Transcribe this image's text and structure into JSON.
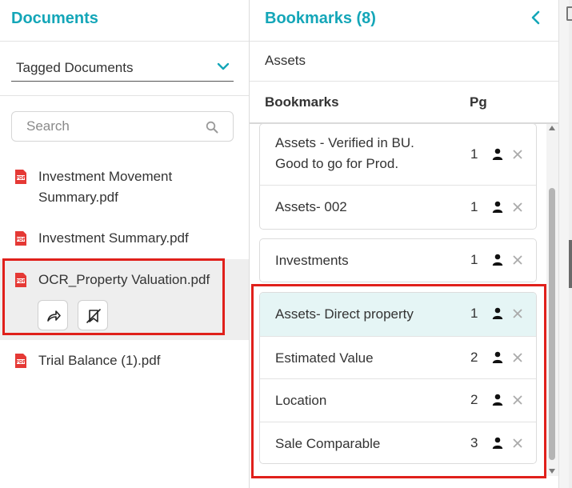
{
  "documents_panel": {
    "title": "Documents",
    "filter": {
      "selected": "Tagged Documents"
    },
    "search": {
      "placeholder": "Search",
      "value": ""
    },
    "items": [
      {
        "name_line1": "Investment Movement",
        "name_line2": "Summary.pdf"
      },
      {
        "name": "Investment Summary.pdf"
      },
      {
        "name": "OCR_Property Valuation.pdf",
        "selected": true
      },
      {
        "name": "Trial Balance (1).pdf"
      }
    ]
  },
  "bookmarks_panel": {
    "title": "Bookmarks (8)",
    "context": "Assets",
    "columns": {
      "bookmarks": "Bookmarks",
      "page": "Pg"
    },
    "groups": [
      {
        "rows": [
          {
            "label_line1": "Assets - Verified in BU.",
            "label_line2": "Good to go for Prod.",
            "page": "1"
          },
          {
            "label": "Assets- 002",
            "page": "1"
          }
        ]
      },
      {
        "rows": [
          {
            "label": "Investments",
            "page": "1"
          }
        ]
      },
      {
        "rows": [
          {
            "label": "Assets- Direct property",
            "page": "1",
            "active": true
          },
          {
            "label": "Estimated Value",
            "page": "2"
          },
          {
            "label": "Location",
            "page": "2"
          },
          {
            "label": "Sale Comparable",
            "page": "3"
          }
        ]
      }
    ]
  },
  "colors": {
    "accent": "#14a6b8",
    "highlight_border": "#e0201b",
    "pdf_red": "#e53935",
    "active_row": "#e5f5f5"
  },
  "icons": [
    "chevron-down-icon",
    "search-icon",
    "pdf-icon",
    "share-icon",
    "untag-icon",
    "chevron-left-icon",
    "user-icon",
    "close-icon"
  ]
}
